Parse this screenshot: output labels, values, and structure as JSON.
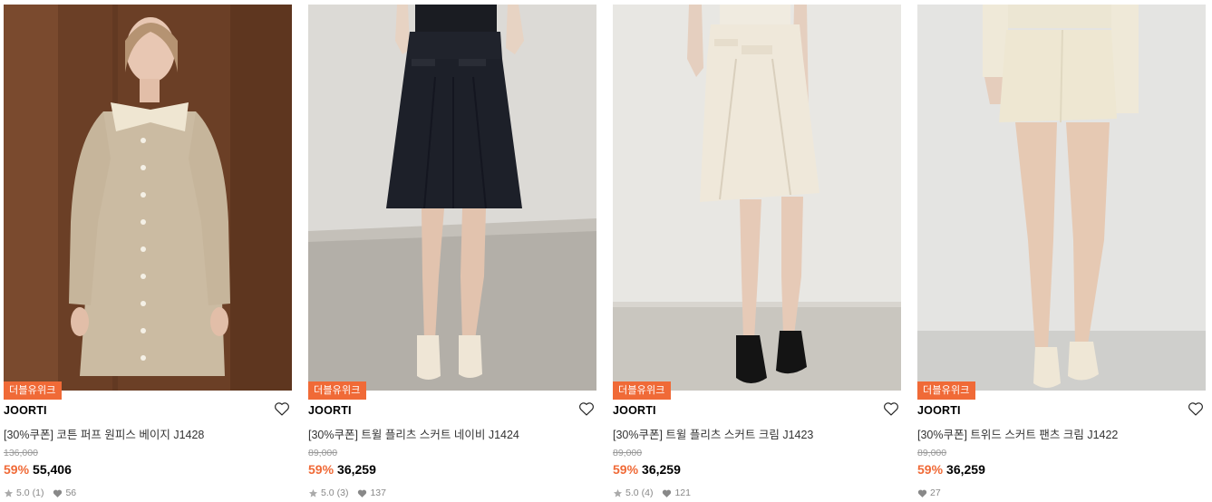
{
  "products": [
    {
      "badge": "더블유위크",
      "brand": "JOORTI",
      "name": "[30%쿠폰] 코튼 퍼프 원피스 베이지 J1428",
      "original_price": "136,000",
      "discount": "59%",
      "price": "55,406",
      "rating": "5.0",
      "reviews": "(1)",
      "likes": "56",
      "image": "model-beige-dress"
    },
    {
      "badge": "더블유위크",
      "brand": "JOORTI",
      "name": "[30%쿠폰] 트윌 플리츠 스커트 네이비 J1424",
      "original_price": "89,000",
      "discount": "59%",
      "price": "36,259",
      "rating": "5.0",
      "reviews": "(3)",
      "likes": "137",
      "image": "model-navy-skirt"
    },
    {
      "badge": "더블유위크",
      "brand": "JOORTI",
      "name": "[30%쿠폰] 트윌 플리츠 스커트 크림 J1423",
      "original_price": "89,000",
      "discount": "59%",
      "price": "36,259",
      "rating": "5.0",
      "reviews": "(4)",
      "likes": "121",
      "image": "model-cream-skirt"
    },
    {
      "badge": "더블유위크",
      "brand": "JOORTI",
      "name": "[30%쿠폰] 트위드 스커트 팬츠 크림 J1422",
      "original_price": "89,000",
      "discount": "59%",
      "price": "36,259",
      "likes": "27",
      "image": "model-tweed-skirt"
    }
  ],
  "colors": {
    "accent": "#f06a37",
    "meta": "#888888",
    "strike": "#999999"
  },
  "icons": {
    "like": "heart-outline-icon",
    "rating": "star-icon",
    "likes_count": "heart-filled-icon"
  }
}
